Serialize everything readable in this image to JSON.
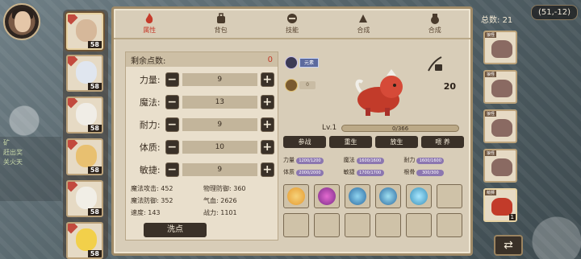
{
  "coord_display": "(51,-12)",
  "top_left_chat": [
    "矿",
    "赶出奖",
    "关火天"
  ],
  "characters": [
    {
      "level": "58",
      "head_color": "#d6b89a",
      "selected": true
    },
    {
      "level": "58",
      "head_color": "#e0e6ef",
      "selected": false
    },
    {
      "level": "58",
      "head_color": "#f0ede6",
      "selected": false
    },
    {
      "level": "58",
      "head_color": "#e8c070",
      "selected": false
    },
    {
      "level": "58",
      "head_color": "#f1eee6",
      "selected": false
    },
    {
      "level": "58",
      "head_color": "#f2d04a",
      "selected": false
    }
  ],
  "tabs": [
    {
      "label": "属性",
      "active": true
    },
    {
      "label": "背包",
      "active": false
    },
    {
      "label": "技能",
      "active": false
    },
    {
      "label": "合成",
      "active": false
    },
    {
      "label": "合成",
      "active": false
    }
  ],
  "attributes": {
    "remaining_label": "剩余点数:",
    "remaining_value": "0",
    "rows": [
      {
        "label": "力量:",
        "value": "9"
      },
      {
        "label": "魔法:",
        "value": "13"
      },
      {
        "label": "耐力:",
        "value": "9"
      },
      {
        "label": "体质:",
        "value": "10"
      },
      {
        "label": "敏捷:",
        "value": "9"
      }
    ],
    "derived": [
      {
        "label": "魔法攻击:",
        "value": "452"
      },
      {
        "label": "物理防御:",
        "value": "360"
      },
      {
        "label": "魔法防御:",
        "value": "352"
      },
      {
        "label": "气血:",
        "value": "2626"
      },
      {
        "label": "速度:",
        "value": "143"
      },
      {
        "label": "战力:",
        "value": "1101"
      }
    ],
    "wash_label": "洗点"
  },
  "creature": {
    "tag_text": "元素",
    "sub_text": "0",
    "bonus_value": "20",
    "level_label": "Lv.1",
    "exp_text": "0/366",
    "actions": [
      "参战",
      "重生",
      "放生",
      "喂 养"
    ],
    "stats": [
      {
        "label": "力量",
        "value": "1200/1200"
      },
      {
        "label": "魔法",
        "value": "1600/1600"
      },
      {
        "label": "耐力",
        "value": "1600/1600"
      },
      {
        "label": "体质",
        "value": "2000/2000"
      },
      {
        "label": "敏捷",
        "value": "1700/1700"
      },
      {
        "label": "根骨",
        "value": "300/300"
      }
    ],
    "skill_colors": [
      "#e59a2f",
      "#7a2c88",
      "#2c6aa0",
      "#2c6aa0",
      "#3a8fb8"
    ],
    "empty_skill_slots": 7
  },
  "monsters": {
    "total_label": "总数:",
    "total_value": "21",
    "items": [
      {
        "tag": "狼怪"
      },
      {
        "tag": "狼怪"
      },
      {
        "tag": "狼怪"
      },
      {
        "tag": "狼怪"
      },
      {
        "tag": "萌狮",
        "badge": "1"
      }
    ]
  },
  "colors": {
    "accent_red": "#c23b2a",
    "dark_button": "#3a3128",
    "panel_bg": "#d8cdb8"
  }
}
